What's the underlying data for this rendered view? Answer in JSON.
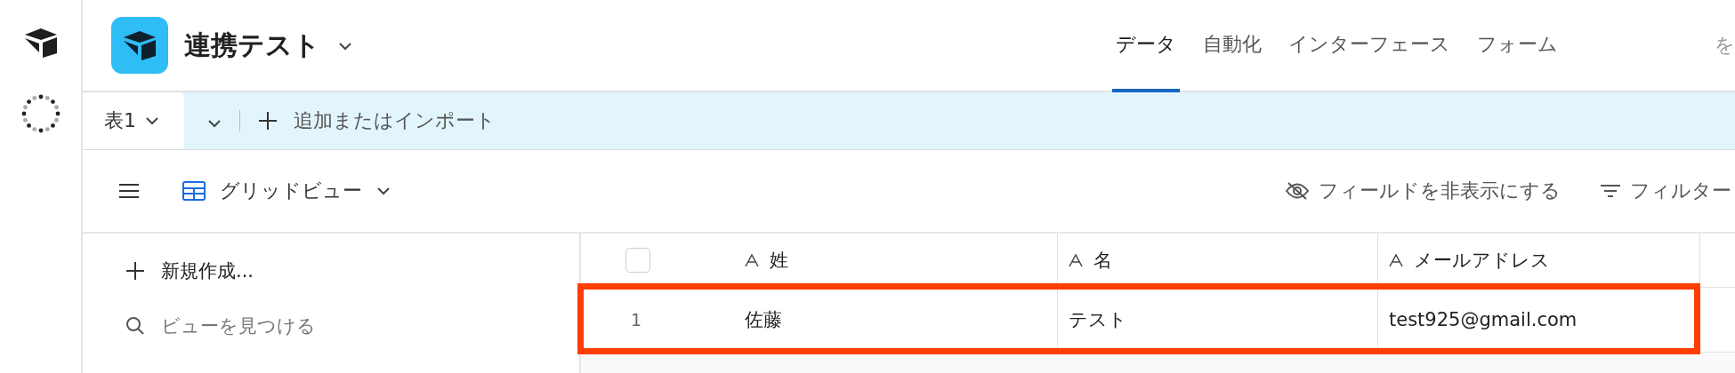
{
  "base": {
    "title": "連携テスト"
  },
  "nav_tabs": [
    {
      "label": "データ",
      "selected": true
    },
    {
      "label": "自動化",
      "selected": false
    },
    {
      "label": "インターフェース",
      "selected": false
    },
    {
      "label": "フォーム",
      "selected": false
    }
  ],
  "header_cut_text": "を",
  "table_tabs": [
    {
      "label": "表1",
      "selected": true
    }
  ],
  "add_import": "追加またはインポート",
  "view": {
    "name": "グリッドビュー"
  },
  "toolbar_actions": [
    {
      "kind": "hide",
      "label": "フィールドを非表示にする"
    },
    {
      "kind": "filter",
      "label": "フィルター"
    }
  ],
  "sidebar": {
    "create": "新規作成...",
    "search_placeholder": "ビューを見つける"
  },
  "table": {
    "select_all_checked": false,
    "columns": [
      "姓",
      "名",
      "メールアドレス"
    ],
    "rows": [
      {
        "number": "1",
        "cells": [
          "佐藤",
          "テスト",
          "test925@gmail.com"
        ],
        "highlighted": true
      }
    ]
  }
}
